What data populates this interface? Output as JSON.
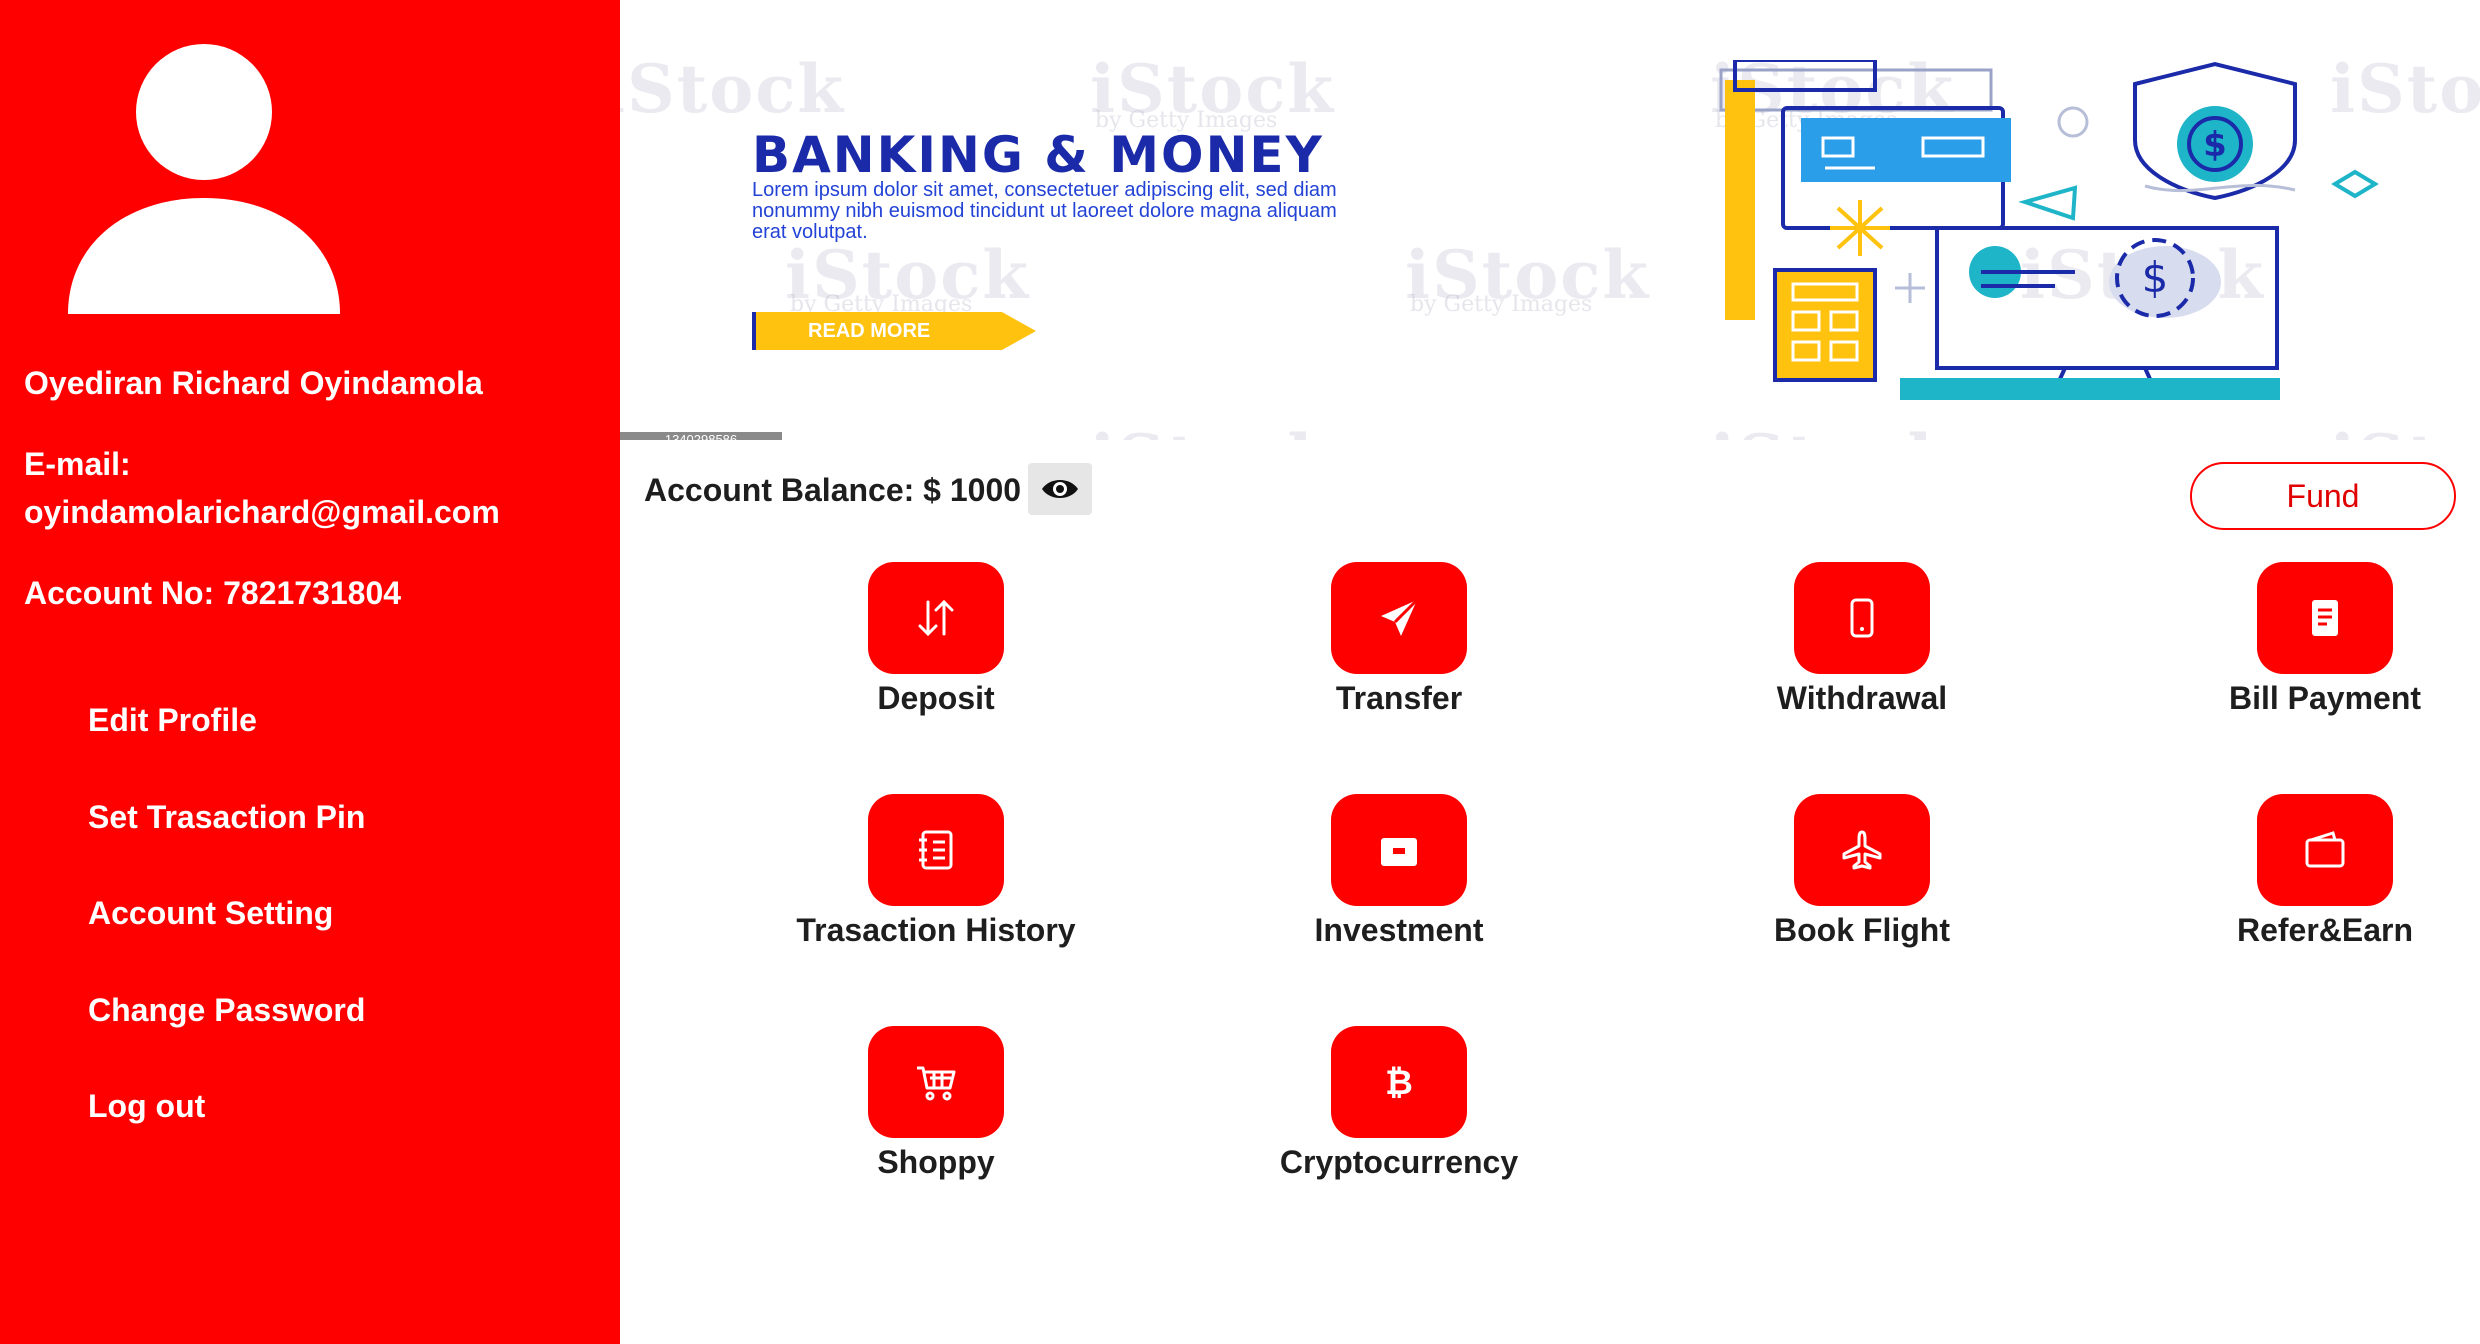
{
  "sidebar": {
    "profile": {
      "name": "Oyediran Richard Oyindamola",
      "email_label": "E-mail:",
      "email": "oyindamolarichard@gmail.com",
      "account": "Account No: 7821731804"
    },
    "items": [
      {
        "label": "Edit Profile"
      },
      {
        "label": "Set Trasaction Pin"
      },
      {
        "label": "Account Setting"
      },
      {
        "label": "Change Password"
      },
      {
        "label": "Log out"
      }
    ]
  },
  "banner": {
    "title": "BANKING & MONEY",
    "text": "Lorem ipsum dolor sit amet, consectetuer adipiscing elit, sed diam nonummy nibh euismod tincidunt ut laoreet dolore magna aliquam erat volutpat.",
    "read_more": "READ MORE",
    "watermark": "iStock",
    "watermark_sub": "by Getty Images",
    "image_id": "1340298586"
  },
  "balance": {
    "label": "Account Balance: $ 1000",
    "fund_label": "Fund"
  },
  "services": [
    {
      "label": "Deposit",
      "icon": "arrows-up-down-icon"
    },
    {
      "label": "Transfer",
      "icon": "send-icon"
    },
    {
      "label": "Withdrawal",
      "icon": "phone-icon"
    },
    {
      "label": "Bill Payment",
      "icon": "document-icon"
    },
    {
      "label": "Trasaction History",
      "icon": "journal-icon"
    },
    {
      "label": "Investment",
      "icon": "briefcase-icon"
    },
    {
      "label": "Book Flight",
      "icon": "airplane-icon"
    },
    {
      "label": "Refer&Earn",
      "icon": "wallet-icon"
    },
    {
      "label": "Shoppy",
      "icon": "cart-icon"
    },
    {
      "label": "Cryptocurrency",
      "icon": "bitcoin-icon"
    }
  ],
  "colors": {
    "accent": "#fe0000",
    "text": "#1e1e1e"
  }
}
